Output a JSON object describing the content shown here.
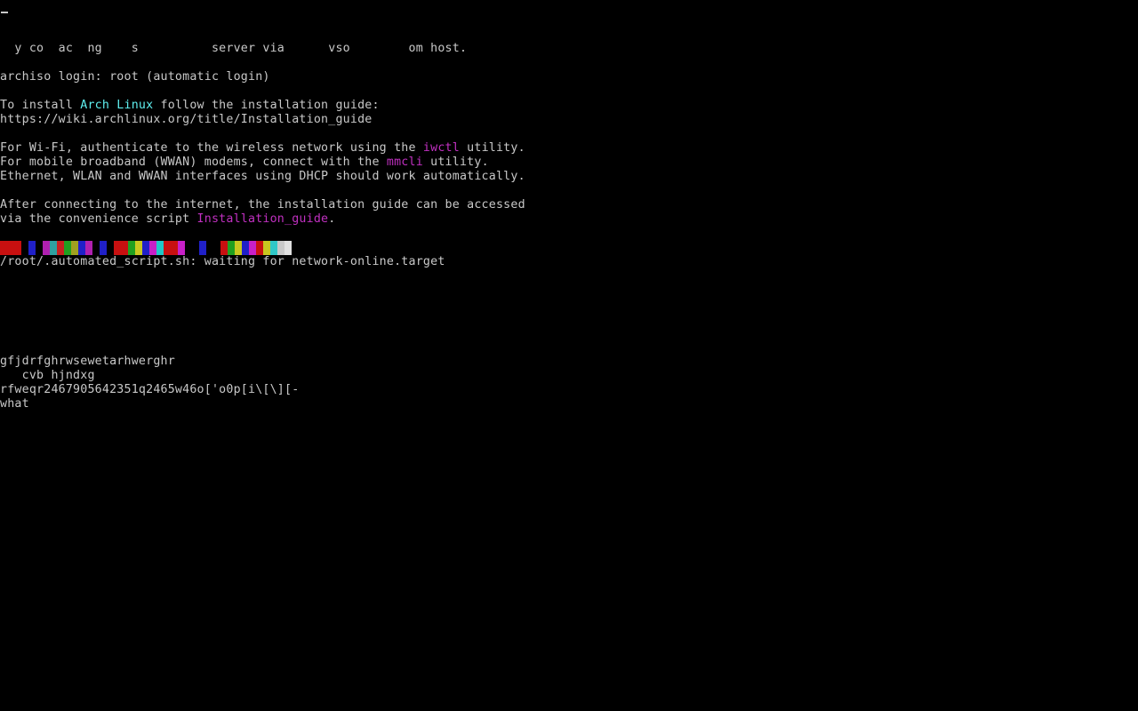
{
  "console": {
    "garbled_line": "  y co  ac  ng    s          server via      vso        om host.",
    "login_line": "archiso login: root (automatic login)",
    "install_prefix": "To install ",
    "install_highlight": "Arch Linux",
    "install_suffix": " follow the installation guide:",
    "guide_url": "https://wiki.archlinux.org/title/Installation_guide",
    "wifi_prefix": "For Wi-Fi, authenticate to the wireless network using the ",
    "wifi_tool": "iwctl",
    "wifi_suffix": " utility.",
    "wwan_prefix": "For mobile broadband (WWAN) modems, connect with the ",
    "wwan_tool": "mmcli",
    "wwan_suffix": " utility.",
    "ethernet_line": "Ethernet, WLAN and WWAN interfaces using DHCP should work automatically.",
    "after_line": "After connecting to the internet, the installation guide can be accessed",
    "via_prefix": "via the convenience script ",
    "via_script": "Installation_guide",
    "via_suffix": ".",
    "script_line": "/root/.automated_script.sh: waiting for network-online.target",
    "typed_1": "gfjdrfghrwsewetarhwerghr",
    "typed_2": "   cvb hjndxg",
    "typed_3": "rfweqr2467905642351q2465w46o['o0p[i\\[\\][-",
    "typed_4": "what"
  },
  "colors": {
    "background": "#000000",
    "foreground": "#c8c8c8",
    "highlight_cyan": "#5ff0f0",
    "highlight_magenta": "#c030c0"
  },
  "palette_colors": [
    "#c81010",
    "#c81010",
    "#c81010",
    "#000000",
    "#2020c8",
    "#000000",
    "#b020b0",
    "#30a0a0",
    "#c82020",
    "#20a020",
    "#a0a020",
    "#2020c8",
    "#b020b0",
    "#000000",
    "#2020c8",
    "#000000",
    "#c81010",
    "#c81010",
    "#20a020",
    "#c8c820",
    "#2020c8",
    "#c820c8",
    "#20c8c8",
    "#c81010",
    "#c81010",
    "#c820c8",
    "#000000",
    "#000000",
    "#2020c8",
    "#000000",
    "#000000",
    "#c81010",
    "#20a020",
    "#c8c820",
    "#2020c8",
    "#c820c8",
    "#c81010",
    "#c8c820",
    "#30c8c8",
    "#c8c8c8",
    "#e0e0e0",
    "#000000"
  ]
}
